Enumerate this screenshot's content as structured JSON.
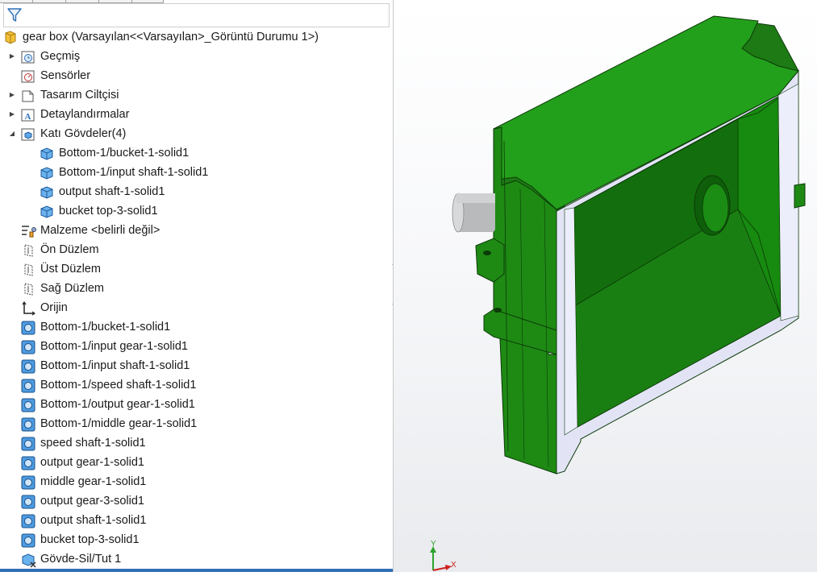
{
  "feature_tree": {
    "root": {
      "label": "gear box  (Varsayılan<<Varsayılan>_Görüntü Durumu 1>)",
      "icon": "part-icon"
    },
    "items": [
      {
        "label": "Geçmiş",
        "icon": "history-icon",
        "expandable": true
      },
      {
        "label": "Sensörler",
        "icon": "sensor-icon",
        "expandable": false
      },
      {
        "label": "Tasarım Ciltçisi",
        "icon": "design-binder-icon",
        "expandable": true
      },
      {
        "label": "Detaylandırmalar",
        "icon": "annotations-icon",
        "expandable": true
      },
      {
        "label": "Katı Gövdeler(4)",
        "icon": "solid-bodies-folder-icon",
        "expandable": true,
        "expanded": true
      },
      {
        "label": "Bottom-1/bucket-1-solid1",
        "icon": "solid-body-icon",
        "child": true
      },
      {
        "label": "Bottom-1/input shaft-1-solid1",
        "icon": "solid-body-icon",
        "child": true
      },
      {
        "label": "output shaft-1-solid1",
        "icon": "solid-body-icon",
        "child": true
      },
      {
        "label": "bucket top-3-solid1",
        "icon": "solid-body-icon",
        "child": true
      },
      {
        "label": "Malzeme <belirli değil>",
        "icon": "material-icon"
      },
      {
        "label": "Ön Düzlem",
        "icon": "plane-icon"
      },
      {
        "label": "Üst Düzlem",
        "icon": "plane-icon"
      },
      {
        "label": "Sağ Düzlem",
        "icon": "plane-icon"
      },
      {
        "label": "Orijin",
        "icon": "origin-icon"
      },
      {
        "label": "Bottom-1/bucket-1-solid1",
        "icon": "imported-body-icon"
      },
      {
        "label": "Bottom-1/input gear-1-solid1",
        "icon": "imported-body-icon"
      },
      {
        "label": "Bottom-1/input shaft-1-solid1",
        "icon": "imported-body-icon"
      },
      {
        "label": "Bottom-1/speed shaft-1-solid1",
        "icon": "imported-body-icon"
      },
      {
        "label": "Bottom-1/output gear-1-solid1",
        "icon": "imported-body-icon"
      },
      {
        "label": "Bottom-1/middle gear-1-solid1",
        "icon": "imported-body-icon"
      },
      {
        "label": "speed shaft-1-solid1",
        "icon": "imported-body-icon"
      },
      {
        "label": "output gear-1-solid1",
        "icon": "imported-body-icon"
      },
      {
        "label": "middle gear-1-solid1",
        "icon": "imported-body-icon"
      },
      {
        "label": "output gear-3-solid1",
        "icon": "imported-body-icon"
      },
      {
        "label": "output shaft-1-solid1",
        "icon": "imported-body-icon"
      },
      {
        "label": "bucket top-3-solid1",
        "icon": "imported-body-icon"
      },
      {
        "label": "Gövde-Sil/Tut 1",
        "icon": "delete-body-icon"
      }
    ]
  },
  "filter": {
    "icon": "filter-icon"
  },
  "triad": {
    "y_label": "Y",
    "x_label": "X"
  },
  "colors": {
    "model_green": "#1e8a14",
    "section_face": "#e2e4f6",
    "selection_blue": "#2f6fb5"
  }
}
